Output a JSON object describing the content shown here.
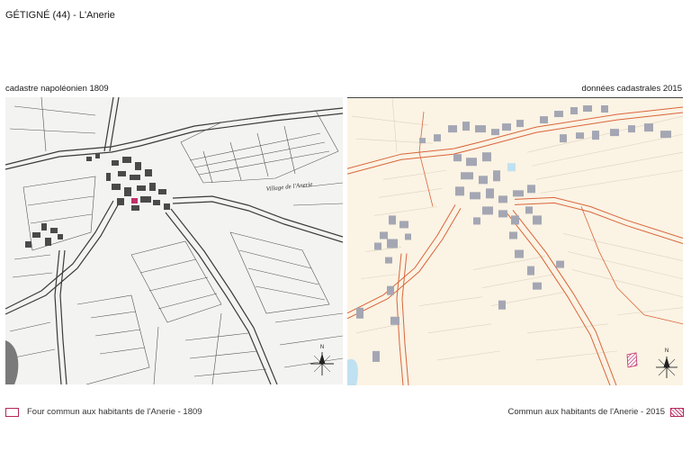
{
  "page_title": "GÉTIGNÉ (44) - L'Anerie",
  "left_map": {
    "label": "cadastre napoléonien 1809",
    "place_name": "Village de l'Anerie",
    "north_label": "N"
  },
  "right_map": {
    "label": "données cadastrales 2015",
    "north_label": "N"
  },
  "legend": {
    "left_text": "Four commun aux habitants de l'Anerie - 1809",
    "right_text": "Commun aux habitants de l'Anerie - 2015"
  },
  "colors": {
    "old_map_ink": "#3a3a3a",
    "old_map_paper": "#f3f3f1",
    "modern_background": "#fbf3e4",
    "modern_roads": "#d9653a",
    "modern_buildings": "#a4a7b3",
    "water": "#bfe1f1",
    "highlight": "#c0306a"
  }
}
